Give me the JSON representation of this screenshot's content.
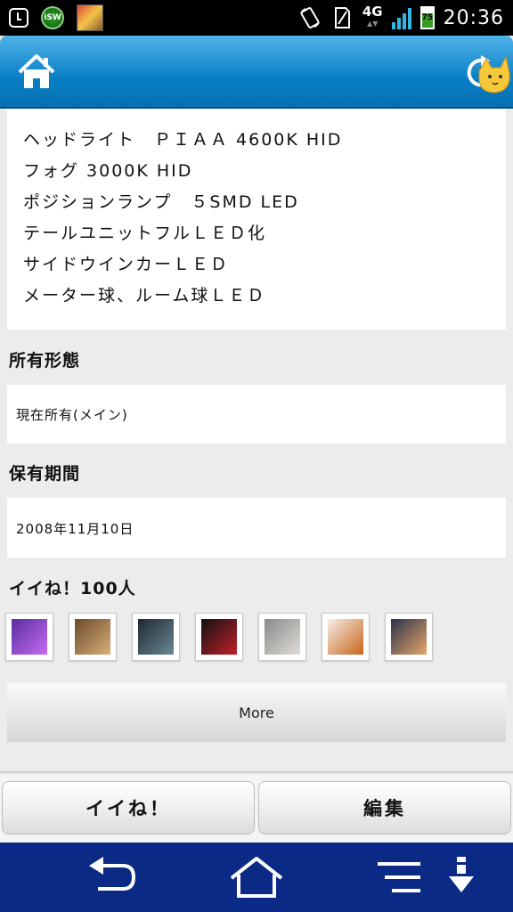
{
  "status_bar": {
    "time": "20:36",
    "network": "4G",
    "battery": "75",
    "battery_level": 0.75,
    "signal_bars": 4,
    "left_icons": [
      "alarm-icon",
      "isw-app-icon",
      "notification-thumbnail"
    ],
    "right_icons": [
      "rotation-lock-icon",
      "no-sim-icon"
    ]
  },
  "header": {
    "home_icon": "home-icon",
    "refresh_icon": "refresh-cat-icon"
  },
  "parts_list": [
    "ヘッドライト　ＰＩＡＡ 4600K HID",
    "フォグ 3000K HID",
    "ポジションランプ　５SMD LED",
    "テールユニットフルＬＥＤ化",
    "サイドウインカーＬＥＤ",
    "メーター球、ルーム球ＬＥＤ"
  ],
  "ownership": {
    "label": "所有形態",
    "value": "現在所有(メイン)"
  },
  "period": {
    "label": "保有期間",
    "value": "2008年11月10日"
  },
  "likes": {
    "label": "イイね！100人",
    "thumbnails": [
      {
        "name": "thumb-purple-logo",
        "colors": [
          "#5b2ca0",
          "#c46cf0"
        ]
      },
      {
        "name": "thumb-cats",
        "colors": [
          "#6b4a2a",
          "#d9b07a"
        ]
      },
      {
        "name": "thumb-car-dark",
        "colors": [
          "#1e2a30",
          "#6b8796"
        ]
      },
      {
        "name": "thumb-red-black",
        "colors": [
          "#111111",
          "#c0202a"
        ]
      },
      {
        "name": "thumb-cat-gray",
        "colors": [
          "#8a8a8a",
          "#e0dcd6"
        ]
      },
      {
        "name": "thumb-toys-orange",
        "colors": [
          "#f5efe6",
          "#c8641c"
        ]
      },
      {
        "name": "thumb-sunset",
        "colors": [
          "#28324a",
          "#e7a66a"
        ]
      }
    ]
  },
  "more_button": "More",
  "actions": {
    "like": "イイね！",
    "edit": "編集"
  },
  "navbar": {
    "back_icon": "back-icon",
    "home_icon": "home-icon",
    "menu_icon": "menu-icon",
    "download_icon": "download-icon"
  }
}
